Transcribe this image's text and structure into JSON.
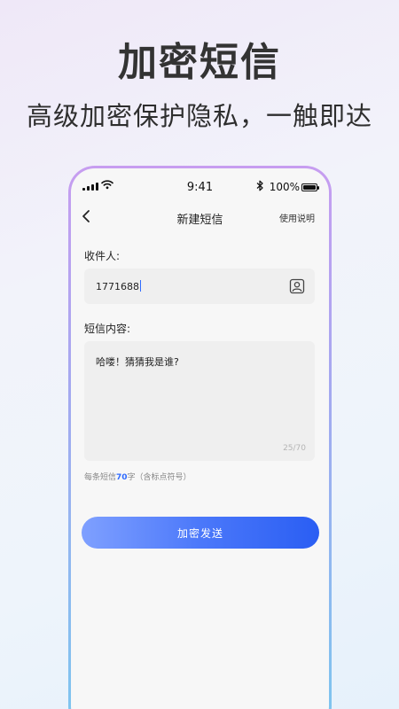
{
  "hero": {
    "title": "加密短信",
    "subtitle": "高级加密保护隐私，一触即达"
  },
  "status_bar": {
    "time": "9:41",
    "battery": "100%"
  },
  "nav": {
    "title": "新建短信",
    "help_label": "使用说明"
  },
  "form": {
    "recipient_label": "收件人:",
    "recipient_value": "1771688",
    "content_label": "短信内容:",
    "content_value": "哈喽！猜猜我是谁?",
    "counter": "25/70",
    "hint_prefix": "每条短信",
    "hint_number": "70",
    "hint_suffix": "字（含标点符号）"
  },
  "send_button_label": "加密发送",
  "colors": {
    "accent": "#2f6bff",
    "button_start": "#7fa0ff",
    "button_end": "#2a5ef3"
  }
}
